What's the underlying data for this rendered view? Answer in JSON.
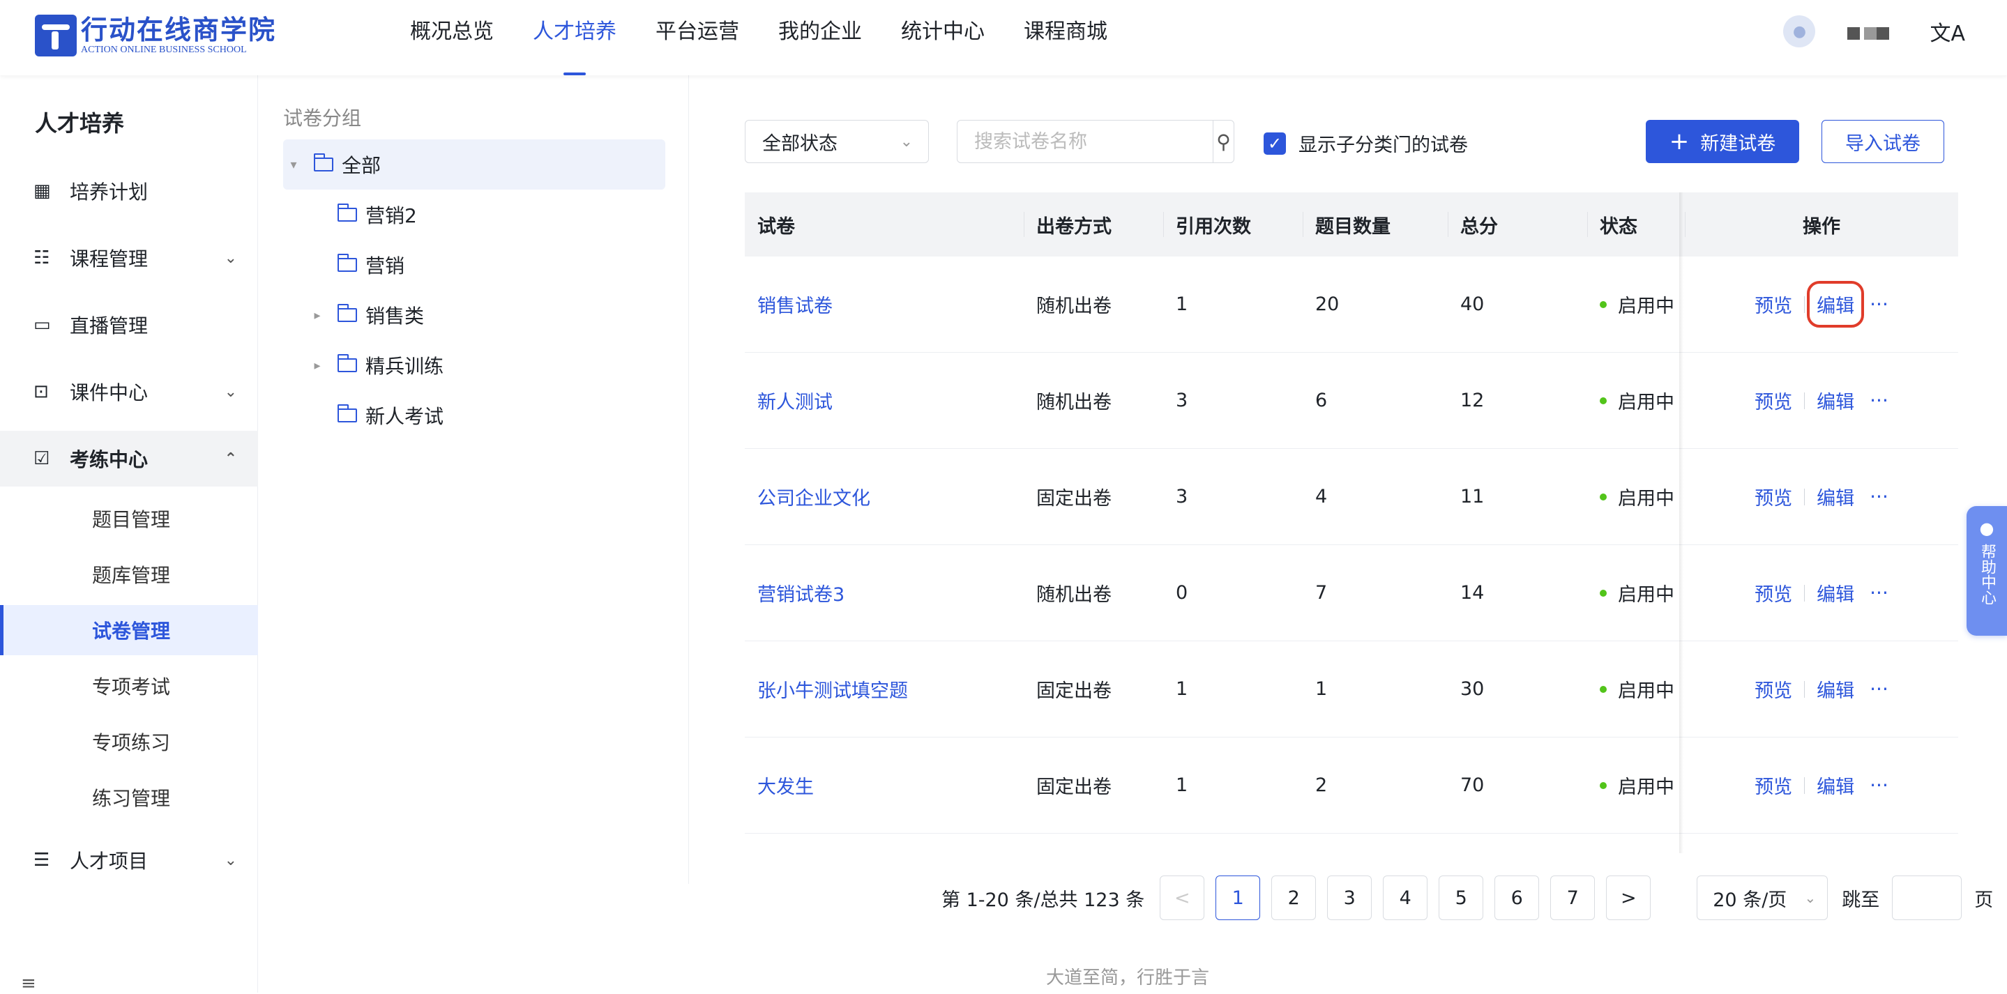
{
  "logo": {
    "cn": "行动在线商学院",
    "en": "ACTION ONLINE BUSINESS SCHOOL"
  },
  "nav": {
    "items": [
      "概况总览",
      "人才培养",
      "平台运营",
      "我的企业",
      "统计中心",
      "课程商城"
    ],
    "active_index": 1
  },
  "header": {
    "avatar_icon": "user-avatar-icon",
    "translate_icon": "translate-icon",
    "translate_glyph": "文A"
  },
  "sidebar": {
    "title": "人才培养",
    "items": [
      {
        "label": "培养计划",
        "icon": "calendar-icon",
        "glyph": "▦"
      },
      {
        "label": "课程管理",
        "icon": "book-icon",
        "glyph": "☷"
      },
      {
        "label": "直播管理",
        "icon": "video-icon",
        "glyph": "▭"
      },
      {
        "label": "课件中心",
        "icon": "inbox-icon",
        "glyph": "⊡"
      },
      {
        "label": "考练中心",
        "icon": "exam-icon",
        "glyph": "☑"
      },
      {
        "label": "人才项目",
        "icon": "project-icon",
        "glyph": "☰"
      }
    ],
    "subitems": [
      "题目管理",
      "题库管理",
      "试卷管理",
      "专项考试",
      "专项练习",
      "练习管理"
    ],
    "active_sub": "试卷管理"
  },
  "tree": {
    "title": "试卷分组",
    "nodes": [
      "全部",
      "营销2",
      "营销",
      "销售类",
      "精兵训练",
      "新人考试"
    ]
  },
  "toolbar": {
    "status_select": "全部状态",
    "search_placeholder": "搜索试卷名称",
    "checkbox_label": "显示子分类门的试卷",
    "checkbox_checked": true,
    "new_button": "新建试卷",
    "import_button": "导入试卷"
  },
  "table": {
    "headers": [
      "试卷",
      "出卷方式",
      "引用次数",
      "题目数量",
      "总分",
      "状态",
      "操作"
    ],
    "rows": [
      {
        "name": "销售试卷",
        "mode": "随机出卷",
        "refs": "1",
        "count": "20",
        "score": "40",
        "status": "启用中"
      },
      {
        "name": "新人测试",
        "mode": "随机出卷",
        "refs": "3",
        "count": "6",
        "score": "12",
        "status": "启用中"
      },
      {
        "name": "公司企业文化",
        "mode": "固定出卷",
        "refs": "3",
        "count": "4",
        "score": "11",
        "status": "启用中"
      },
      {
        "name": "营销试卷3",
        "mode": "随机出卷",
        "refs": "0",
        "count": "7",
        "score": "14",
        "status": "启用中"
      },
      {
        "name": "张小牛测试填空题",
        "mode": "固定出卷",
        "refs": "1",
        "count": "1",
        "score": "30",
        "status": "启用中"
      },
      {
        "name": "大发生",
        "mode": "固定出卷",
        "refs": "1",
        "count": "2",
        "score": "70",
        "status": "启用中"
      }
    ],
    "ops": {
      "preview": "预览",
      "edit": "编辑",
      "more": "···"
    },
    "status_color": "#52c41a"
  },
  "pagination": {
    "summary": "第 1-20 条/总共 123 条",
    "pages": [
      "1",
      "2",
      "3",
      "4",
      "5",
      "6",
      "7"
    ],
    "current": "1",
    "prev": "<",
    "next": ">",
    "page_size": "20 条/页",
    "jump_label": "跳至",
    "page_suffix": "页"
  },
  "footer": {
    "slogan": "大道至简，行胜于言"
  },
  "help": {
    "label": "帮助中心"
  },
  "colors": {
    "primary": "#2d56db",
    "highlight": "#e03c2a"
  }
}
